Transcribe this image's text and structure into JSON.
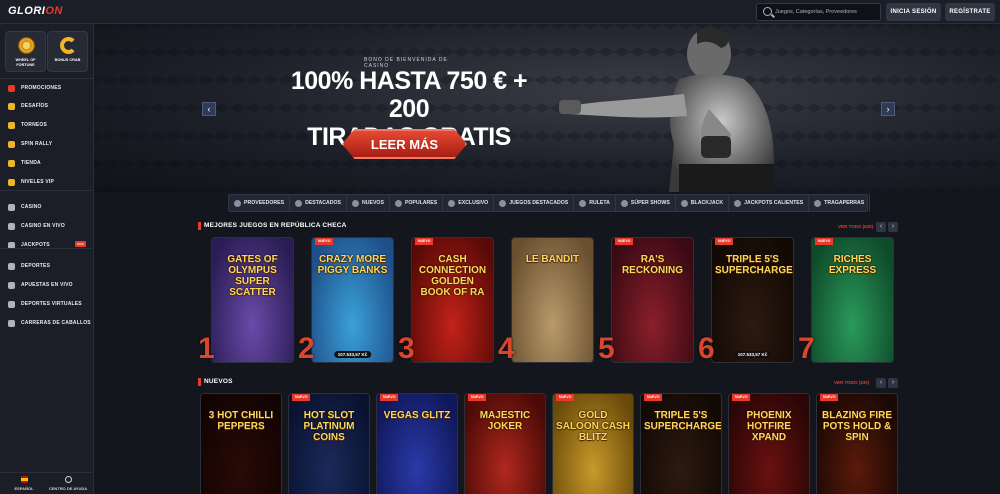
{
  "header": {
    "logo_main": "GLORI",
    "logo_accent": "ON",
    "search_placeholder": "Juegos, Categorías, Proveedores",
    "login_label": "INICIA SESIÓN",
    "register_label": "REGÍSTRATE"
  },
  "sidebar": {
    "tiles": [
      {
        "label": "WHEEL OF FORTUNE",
        "icon": "wheel-icon"
      },
      {
        "label": "BONUS CRAB",
        "icon": "crab-claw-icon"
      }
    ],
    "items": [
      {
        "label": "PROMOCIONES",
        "icon": "gift-icon",
        "color": "#e8392b"
      },
      {
        "label": "DESAFÍOS",
        "icon": "target-icon",
        "color": "#f0b429"
      },
      {
        "label": "TORNEOS",
        "icon": "trophy-icon",
        "color": "#f0b429"
      },
      {
        "label": "SPIN RALLY",
        "icon": "spin-icon",
        "color": "#f0b429"
      },
      {
        "label": "TIENDA",
        "icon": "shop-icon",
        "color": "#f0b429"
      },
      {
        "label": "NIVELES VIP",
        "icon": "crown-icon",
        "color": "#f0b429"
      },
      {
        "label": "CASINO",
        "icon": "slot-icon",
        "color": "#aeb3bf"
      },
      {
        "label": "CASINO EN VIVO",
        "icon": "live-icon",
        "color": "#aeb3bf"
      },
      {
        "label": "JACKPOTS",
        "icon": "clover-icon",
        "color": "#aeb3bf",
        "tag": "NEW"
      },
      {
        "label": "DEPORTES",
        "icon": "ball-icon",
        "color": "#aeb3bf"
      },
      {
        "label": "APUESTAS EN VIVO",
        "icon": "live-bet-icon",
        "color": "#aeb3bf"
      },
      {
        "label": "DEPORTES VIRTUALES",
        "icon": "virtual-icon",
        "color": "#aeb3bf"
      },
      {
        "label": "CARRERAS DE CABALLOS",
        "icon": "horse-icon",
        "color": "#aeb3bf"
      }
    ],
    "bottom": [
      {
        "label": "ESPAÑOL",
        "icon": "flag-es-icon"
      },
      {
        "label": "CENTRO DE AYUDA",
        "icon": "help-icon"
      }
    ]
  },
  "banner": {
    "kicker": "BONO DE BIENVENIDA DE CASINO",
    "headline_line1": "100% HASTA 750 € + 200",
    "headline_line2": "TIRADAS GRATIS",
    "cta": "LEER MÁS",
    "prev": "‹",
    "next": "›"
  },
  "categories": [
    {
      "label": "PROVEEDORES",
      "icon": "providers-icon"
    },
    {
      "label": "DESTACADOS",
      "icon": "star-icon"
    },
    {
      "label": "NUEVOS",
      "icon": "bolt-icon"
    },
    {
      "label": "POPULARES",
      "icon": "fire-icon"
    },
    {
      "label": "EXCLUSIVO",
      "icon": "diamond-icon"
    },
    {
      "label": "JUEGOS DESTACADOS",
      "icon": "medal-icon"
    },
    {
      "label": "RULETA",
      "icon": "roulette-icon"
    },
    {
      "label": "SÚPER SHOWS",
      "icon": "mic-icon"
    },
    {
      "label": "BLACKJACK",
      "icon": "cards-icon"
    },
    {
      "label": "JACKPOTS CALIENTES",
      "icon": "jackpot-icon"
    },
    {
      "label": "TRAGAPERRAS",
      "icon": "slot-icon"
    }
  ],
  "top_section": {
    "title": "MEJORES JUEGOS EN REPÚBLICA CHECA",
    "see_all": "VER TODO (630)",
    "games": [
      {
        "rank": "1",
        "title": "GATES OF OLYMPUS SUPER SCATTER",
        "badge": "",
        "jackpot": "",
        "bg": "#6a4aa8",
        "bg2": "#2a1d55"
      },
      {
        "rank": "2",
        "title": "CRAZY MORE PIGGY BANKS",
        "badge": "NUEVO",
        "jackpot": "107.533,57 Kč",
        "bg": "#3aa0d8",
        "bg2": "#1f4f8a"
      },
      {
        "rank": "3",
        "title": "CASH CONNECTION GOLDEN BOOK OF RA",
        "badge": "NUEVO",
        "jackpot": "",
        "bg": "#c2221a",
        "bg2": "#5a0a06"
      },
      {
        "rank": "4",
        "title": "LE BANDIT",
        "badge": "",
        "jackpot": "",
        "bg": "#b89a6a",
        "bg2": "#6a5030"
      },
      {
        "rank": "5",
        "title": "RA'S RECKONING",
        "badge": "NUEVO",
        "jackpot": "",
        "bg": "#8a1f2a",
        "bg2": "#3a0a14"
      },
      {
        "rank": "6",
        "title": "TRIPLE 5'S SUPERCHARGED",
        "badge": "NUEVO",
        "jackpot": "107.533,57 Kč",
        "bg": "#2c1a10",
        "bg2": "#120904"
      },
      {
        "rank": "7",
        "title": "RICHES EXPRESS",
        "badge": "NUEVO",
        "jackpot": "",
        "bg": "#2a9a5a",
        "bg2": "#0f4a2a"
      }
    ]
  },
  "new_section": {
    "title": "NUEVOS",
    "see_all": "VER TODO (330)",
    "games": [
      {
        "title": "3 HOT CHILLI PEPPERS",
        "badge": "",
        "bg": "#2a0a06",
        "bg2": "#120403"
      },
      {
        "title": "HOT SLOT PLATINUM COINS",
        "badge": "NUEVO",
        "bg": "#1a2a5a",
        "bg2": "#0a1230"
      },
      {
        "title": "VEGAS GLITZ",
        "badge": "NUEVO",
        "bg": "#2a3aa8",
        "bg2": "#10185a"
      },
      {
        "title": "MAJESTIC JOKER",
        "badge": "NUEVO",
        "bg": "#b0281e",
        "bg2": "#4a0a06"
      },
      {
        "title": "GOLD SALOON CASH BLITZ",
        "badge": "NUEVO",
        "bg": "#c89a2a",
        "bg2": "#6a4a0a"
      },
      {
        "title": "TRIPLE 5'S SUPERCHARGED",
        "badge": "NUEVO",
        "bg": "#2c1a10",
        "bg2": "#120904"
      },
      {
        "title": "PHOENIX HOTFIRE XPAND",
        "badge": "NUEVO",
        "bg": "#6a1010",
        "bg2": "#2a0606"
      },
      {
        "title": "BLAZING FIRE POTS HOLD & SPIN",
        "badge": "NUEVO",
        "bg": "#5a1a0a",
        "bg2": "#1a0804"
      }
    ]
  },
  "colors": {
    "accent": "#e8392b",
    "bg": "#14161d",
    "panel": "#1b1e27"
  }
}
